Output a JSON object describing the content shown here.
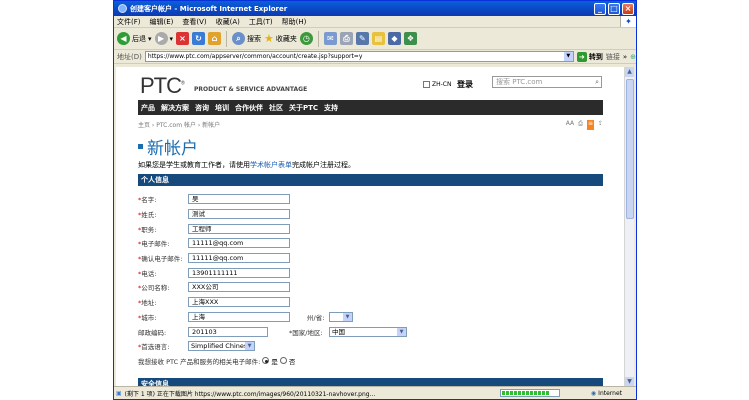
{
  "window": {
    "title": "创建客户帐户 - Microsoft Internet Explorer"
  },
  "menu": [
    "文件(F)",
    "编辑(E)",
    "查看(V)",
    "收藏(A)",
    "工具(T)",
    "帮助(H)"
  ],
  "toolbar": {
    "back": "后退",
    "search": "搜索",
    "favorites": "收藏夹"
  },
  "address": {
    "label": "地址(D)",
    "url": "https://www.ptc.com/appserver/common/account/create.jsp?support=y",
    "go": "转到",
    "links": "链接"
  },
  "page": {
    "logo": "PTC",
    "tagline": "PRODUCT & SERVICE ADVANTAGE",
    "lang": "ZH-CN",
    "login": "登录",
    "search_placeholder": "搜索 PTC.com",
    "nav": [
      "产品",
      "解决方案",
      "咨询",
      "培训",
      "合作伙伴",
      "社区",
      "关于PTC",
      "支持"
    ],
    "breadcrumb": "主页 › PTC.com 帐户 › 新帐户",
    "heading": "新帐户",
    "intro_prefix": "如果您是学生或教育工作者，请使用",
    "intro_link": "学术帐户表单",
    "intro_suffix": "完成帐户注册过程。",
    "section_personal": "个人信息",
    "section_security": "安全信息",
    "fields": {
      "first_name": {
        "label": "名字:",
        "value": "吴"
      },
      "last_name": {
        "label": "姓氏:",
        "value": "测试"
      },
      "job": {
        "label": "职务:",
        "value": "工程师"
      },
      "email": {
        "label": "电子邮件:",
        "value": "11111@qq.com"
      },
      "email_confirm": {
        "label": "确认电子邮件:",
        "value": "11111@qq.com"
      },
      "phone": {
        "label": "电话:",
        "value": "13901111111"
      },
      "company": {
        "label": "公司名称:",
        "value": "XXX公司"
      },
      "address": {
        "label": "地址:",
        "value": "上海XXX"
      },
      "city": {
        "label": "城市:",
        "value": "上海"
      },
      "state": {
        "label": "州/省:",
        "value": ""
      },
      "postal": {
        "label": "邮政编码:",
        "value": "201103"
      },
      "country": {
        "label": "国家/地区:",
        "value": "中国"
      },
      "language": {
        "label": "首选语言:",
        "value": "Simplified Chinese"
      },
      "consent": {
        "label": "我想接收 PTC 产品和服务的相关电子邮件:",
        "yes": "是",
        "no": "否"
      }
    }
  },
  "status": {
    "text": "(剩下 1 项) 正在下载图片 https://www.ptc.com/images/960/20110321-navhover.png...",
    "progress": 0.85,
    "zone": "Internet"
  }
}
